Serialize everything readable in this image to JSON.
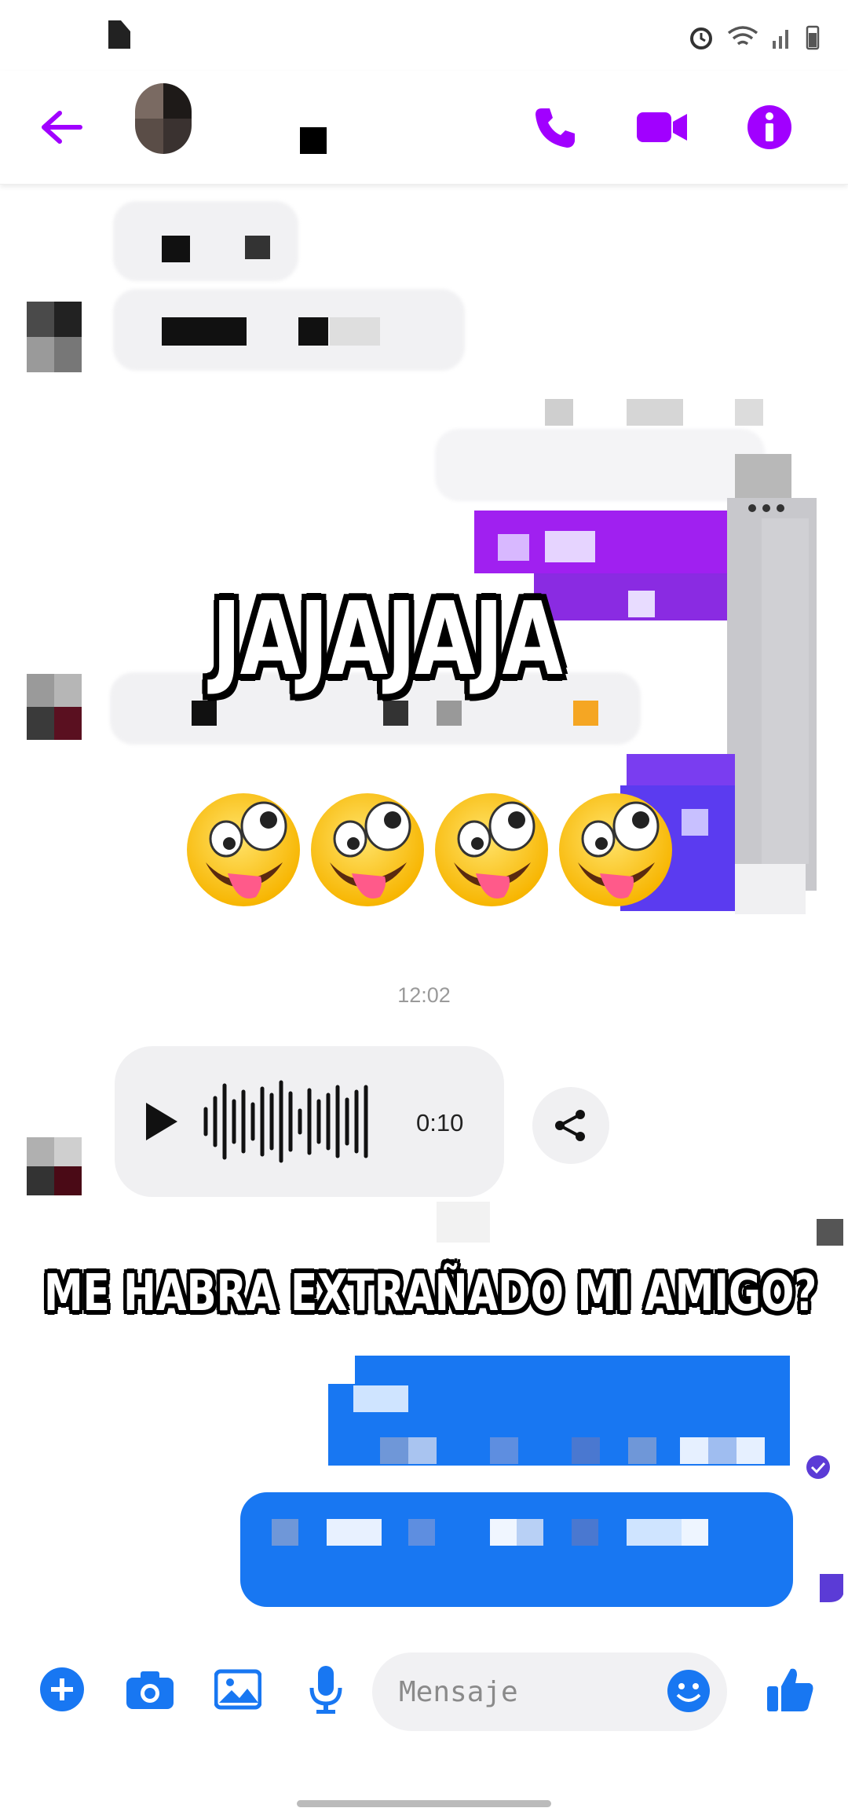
{
  "colors": {
    "accent": "#a100ff",
    "messenger_blue": "#1877f2",
    "bubble_gray": "#f1f1f3"
  },
  "header": {
    "back_icon": "arrow-left-icon",
    "call_icon": "phone-icon",
    "video_icon": "video-camera-icon",
    "info_icon": "info-icon"
  },
  "overlays": {
    "laugh_text": "JAJAJAJA",
    "emoji": "🤪",
    "question_text": "ME HABRA EXTRAÑADO MI AMIGO?"
  },
  "chat": {
    "timestamp": "12:02",
    "voice_message": {
      "duration": "0:10",
      "play_icon": "play-icon",
      "share_icon": "share-icon"
    }
  },
  "composer": {
    "placeholder": "Mensaje",
    "icons": [
      "plus-icon",
      "camera-icon",
      "image-icon",
      "microphone-icon",
      "emoji-icon",
      "thumbs-up-icon"
    ]
  }
}
